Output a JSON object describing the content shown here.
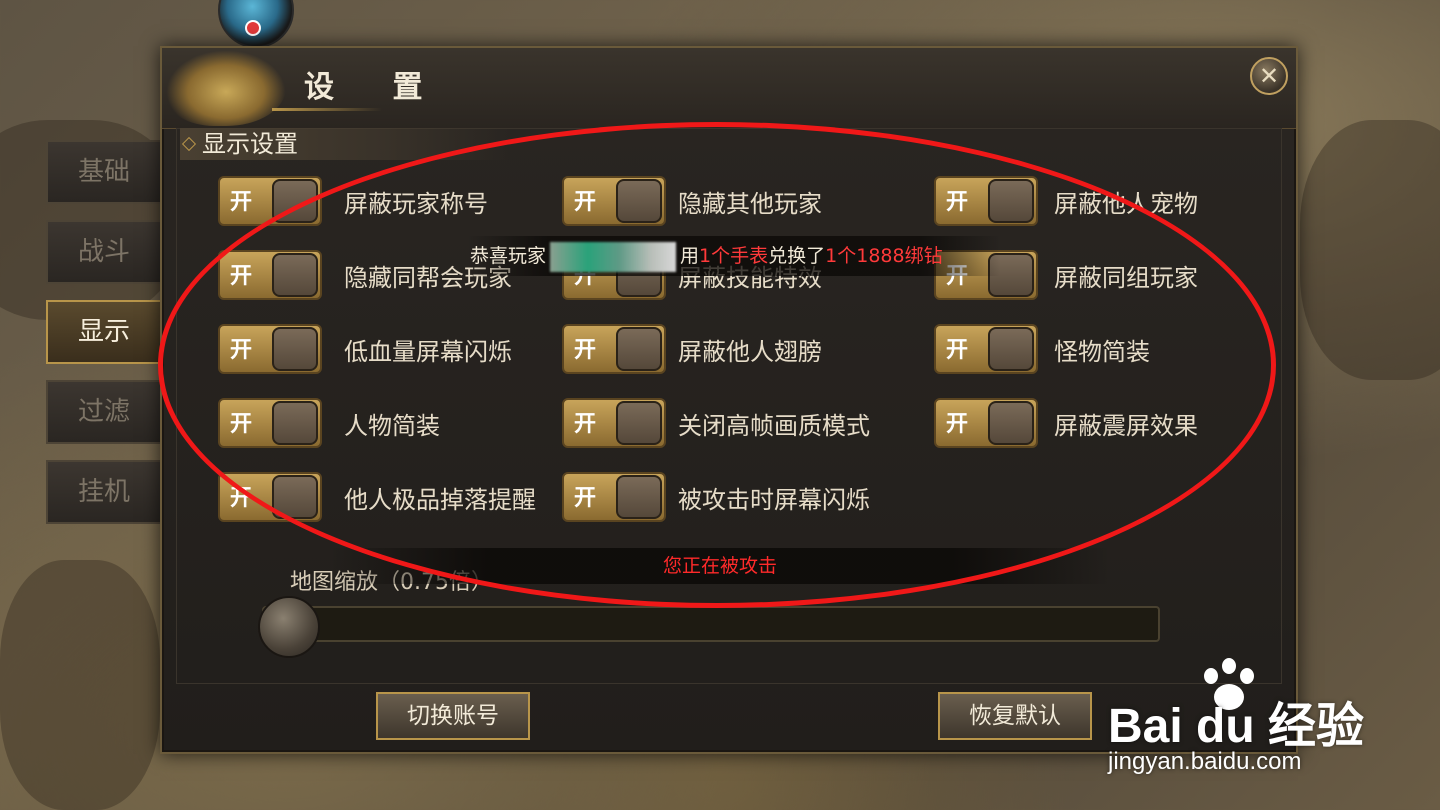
{
  "dialog": {
    "title": "设 置",
    "close_icon": "close-icon"
  },
  "tabs": [
    {
      "label": "基础",
      "active": false
    },
    {
      "label": "战斗",
      "active": false
    },
    {
      "label": "显示",
      "active": true
    },
    {
      "label": "过滤",
      "active": false
    },
    {
      "label": "挂机",
      "active": false
    }
  ],
  "section": {
    "title": "显示设置"
  },
  "toggle_on_text": "开",
  "options": [
    {
      "label": "屏蔽玩家称号",
      "state": "开"
    },
    {
      "label": "隐藏其他玩家",
      "state": "开"
    },
    {
      "label": "屏蔽他人宠物",
      "state": "开"
    },
    {
      "label": "隐藏同帮会玩家",
      "state": "开"
    },
    {
      "label": "屏蔽技能特效",
      "state": "开"
    },
    {
      "label": "屏蔽同组玩家",
      "state": "开"
    },
    {
      "label": "低血量屏幕闪烁",
      "state": "开"
    },
    {
      "label": "屏蔽他人翅膀",
      "state": "开"
    },
    {
      "label": "怪物简装",
      "state": "开"
    },
    {
      "label": "人物简装",
      "state": "开"
    },
    {
      "label": "关闭高帧画质模式",
      "state": "开"
    },
    {
      "label": "屏蔽震屏效果",
      "state": "开"
    },
    {
      "label": "他人极品掉落提醒",
      "state": "开"
    },
    {
      "label": "被攻击时屏幕闪烁",
      "state": "开"
    }
  ],
  "map_zoom": {
    "label": "地图缩放（0.75倍）",
    "value": 0.75
  },
  "buttons": {
    "switch_account": "切换账号",
    "restore_default": "恢复默认"
  },
  "notices": {
    "broadcast_prefix": "恭喜玩家",
    "broadcast_mid1": "用",
    "broadcast_item1": "1个手表",
    "broadcast_mid2": "兑换了",
    "broadcast_item2": "1个1888绑钻",
    "attack": "您正在被攻击"
  },
  "watermark": {
    "brand": "Bai du 经验",
    "url": "jingyan.baidu.com"
  },
  "colors": {
    "accent_gold": "#b8954a",
    "annotation_red": "#f01818",
    "notice_red": "#ff2a2a"
  }
}
